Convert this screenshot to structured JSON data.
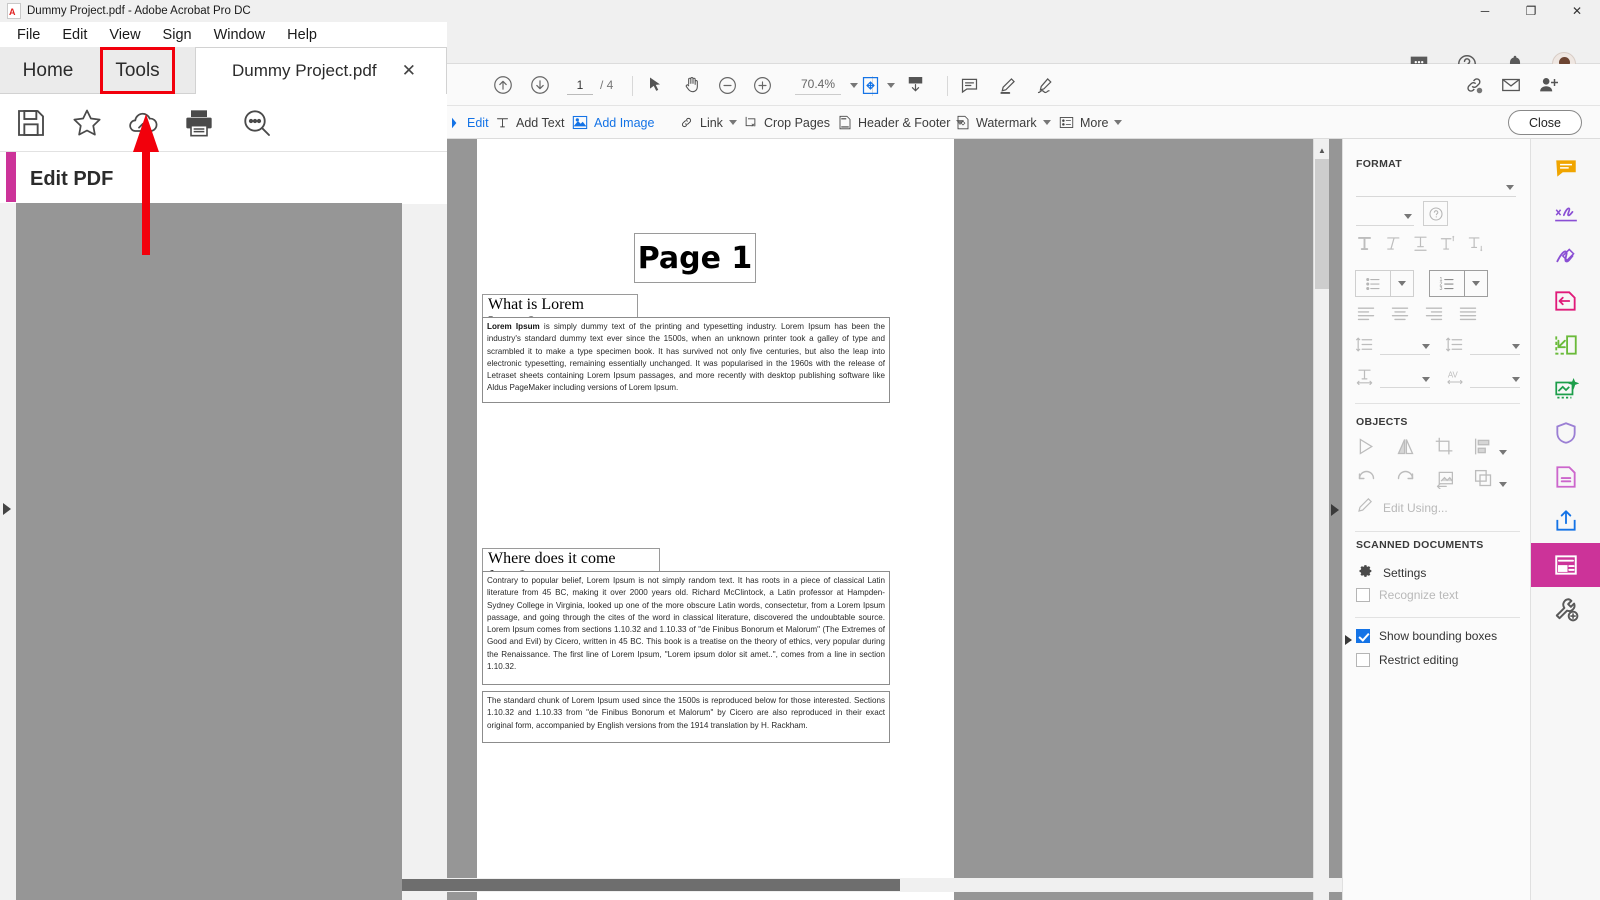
{
  "window": {
    "title": "Dummy Project.pdf - Adobe Acrobat Pro DC",
    "app_icon": "pdf-file-icon",
    "minimize": "─",
    "maximize": "❐",
    "close": "✕"
  },
  "menubar": {
    "items": [
      {
        "label": "File",
        "name": "menu-file"
      },
      {
        "label": "Edit",
        "name": "menu-edit"
      },
      {
        "label": "View",
        "name": "menu-view"
      },
      {
        "label": "Sign",
        "name": "menu-sign"
      },
      {
        "label": "Window",
        "name": "menu-window"
      },
      {
        "label": "Help",
        "name": "menu-help"
      }
    ]
  },
  "tabs": {
    "home": "Home",
    "tools": "Tools",
    "document": "Dummy Project.pdf",
    "close_glyph": "✕",
    "highlight_color": "#f2000c"
  },
  "quick_toolbar": {
    "icons": [
      {
        "name": "save-icon",
        "title": "Save"
      },
      {
        "name": "star-icon",
        "title": "Add to favorites"
      },
      {
        "name": "cloud-upload-icon",
        "title": "Save to cloud"
      },
      {
        "name": "print-icon",
        "title": "Print"
      },
      {
        "name": "search-icon",
        "title": "Find"
      }
    ]
  },
  "tool_header": {
    "label": "Edit PDF",
    "accent_color": "#cc3399"
  },
  "header_icons": [
    {
      "name": "chat-bubble-icon"
    },
    {
      "name": "help-circle-icon"
    },
    {
      "name": "bell-icon"
    },
    {
      "name": "avatar"
    }
  ],
  "navbar": {
    "prev_page_icon": "arrow-up-circle-icon",
    "next_page_icon": "arrow-down-circle-icon",
    "current_page": "1",
    "page_separator": "/ 4",
    "total_pages": "4",
    "select_tool_icon": "cursor-arrow-icon",
    "hand_tool_icon": "hand-icon",
    "zoom_out_icon": "minus-circle-icon",
    "zoom_in_icon": "plus-circle-icon",
    "zoom_level": "70.4%",
    "fit_page_icon": "fit-page-icon",
    "scroll_mode_icon": "scroll-mode-icon",
    "comment_icon": "comment-icon",
    "highlight_icon": "highlighter-icon",
    "draw_icon": "draw-icon",
    "share_link_icon": "share-link-icon",
    "email_icon": "email-icon",
    "add_person_icon": "add-person-icon"
  },
  "edit_toolbar": {
    "items": [
      {
        "label": "Edit",
        "name": "edit-button",
        "icon": "edit-icon",
        "blue": true,
        "caret": false
      },
      {
        "label": "Add Text",
        "name": "add-text-button",
        "icon": "text-icon",
        "blue": false,
        "caret": false
      },
      {
        "label": "Add Image",
        "name": "add-image-button",
        "icon": "image-icon",
        "blue": true,
        "caret": false
      },
      {
        "label": "Link",
        "name": "link-button",
        "icon": "link-icon",
        "blue": false,
        "caret": true
      },
      {
        "label": "Crop Pages",
        "name": "crop-pages-button",
        "icon": "crop-icon",
        "blue": false,
        "caret": false
      },
      {
        "label": "Header & Footer",
        "name": "header-footer-button",
        "icon": "header-footer-icon",
        "blue": false,
        "caret": true
      },
      {
        "label": "Watermark",
        "name": "watermark-button",
        "icon": "watermark-icon",
        "blue": false,
        "caret": true
      },
      {
        "label": "More",
        "name": "more-button",
        "icon": "more-list-icon",
        "blue": false,
        "caret": true
      }
    ],
    "close_label": "Close"
  },
  "document": {
    "page_title": "Page 1",
    "heading_1": "What is Lorem Ipsum?",
    "paragraph_1_bold": "Lorem Ipsum",
    "paragraph_1": " is simply dummy text of the printing and typesetting industry. Lorem Ipsum has been the industry's standard dummy text ever since the 1500s, when an unknown printer took a galley of type and scrambled it to make a type specimen book. It has survived not only five centuries, but also the leap into electronic typesetting, remaining essentially unchanged. It was popularised in the 1960s with the release of Letraset sheets containing Lorem Ipsum passages, and more recently with desktop publishing software like Aldus PageMaker including versions of Lorem Ipsum.",
    "heading_2": "Where does it come from?",
    "paragraph_2": "Contrary to popular belief, Lorem Ipsum is not simply random text. It has roots in a piece of classical Latin literature from 45 BC, making it over 2000 years old. Richard McClintock, a Latin professor at Hampden-Sydney College in Virginia, looked up one of the more obscure Latin words, consectetur, from a Lorem Ipsum passage, and going through the cites of the word in classical literature, discovered the undoubtable source. Lorem Ipsum comes from sections 1.10.32 and 1.10.33 of \"de Finibus Bonorum et Malorum\" (The Extremes of Good and Evil) by Cicero, written in 45 BC. This book is a treatise on the theory of ethics, very popular during the Renaissance. The first line of Lorem Ipsum, \"Lorem ipsum dolor sit amet..\", comes from a line in section 1.10.32.",
    "paragraph_3": "The standard chunk of Lorem Ipsum used since the 1500s is reproduced below for those interested. Sections 1.10.32 and 1.10.33 from \"de Finibus Bonorum et Malorum\" by Cicero are also reproduced in their exact original form, accompanied by English versions from the 1914 translation by H. Rackham."
  },
  "format_panel": {
    "section_format": "FORMAT",
    "section_objects": "OBJECTS",
    "section_scanned": "SCANNED DOCUMENTS",
    "font_dropdown_value": "",
    "font_size_value": "",
    "help_icon": "question-circle-icon",
    "text_style_icons": [
      {
        "name": "bold-icon",
        "glyph": "T"
      },
      {
        "name": "italic-icon",
        "glyph": "T"
      },
      {
        "name": "underline-icon",
        "glyph": "T"
      },
      {
        "name": "superscript-icon",
        "glyph": "T"
      },
      {
        "name": "subscript-icon",
        "glyph": "T"
      }
    ],
    "list_icons": [
      {
        "name": "bulleted-list-icon"
      },
      {
        "name": "bulleted-list-dropdown"
      },
      {
        "name": "numbered-list-icon"
      },
      {
        "name": "numbered-list-dropdown"
      }
    ],
    "align_icons": [
      {
        "name": "align-left-icon"
      },
      {
        "name": "align-center-icon"
      },
      {
        "name": "align-right-icon"
      },
      {
        "name": "align-justify-icon"
      }
    ],
    "spacing_icons": [
      {
        "name": "line-spacing-icon"
      },
      {
        "name": "paragraph-spacing-icon"
      },
      {
        "name": "horizontal-scale-icon"
      },
      {
        "name": "character-spacing-icon"
      }
    ],
    "object_icons_row1": [
      {
        "name": "flip-horizontal-icon"
      },
      {
        "name": "flip-vertical-icon"
      },
      {
        "name": "crop-image-icon"
      },
      {
        "name": "align-objects-icon"
      }
    ],
    "object_icons_row2": [
      {
        "name": "rotate-counterclockwise-icon"
      },
      {
        "name": "rotate-clockwise-icon"
      },
      {
        "name": "replace-image-icon"
      },
      {
        "name": "arrange-objects-icon"
      }
    ],
    "edit_using_label": "Edit Using...",
    "edit_using_icon": "pencil-icon",
    "settings_label": "Settings",
    "settings_icon": "gear-icon",
    "recognize_text_label": "Recognize text",
    "recognize_text_checked": false,
    "show_bounding_boxes_label": "Show bounding boxes",
    "show_bounding_boxes_checked": true,
    "restrict_editing_label": "Restrict editing",
    "restrict_editing_checked": false
  },
  "right_rail": [
    {
      "name": "comment-tool-icon",
      "color": "#f0a500",
      "active": false
    },
    {
      "name": "fill-and-sign-tool-icon",
      "color": "#8a4fd4",
      "active": false
    },
    {
      "name": "sign-tool-icon",
      "color": "#8a4fd4",
      "active": false
    },
    {
      "name": "export-pdf-tool-icon",
      "color": "#e01b7a",
      "active": false
    },
    {
      "name": "create-pdf-tool-icon",
      "color": "#6aba3a",
      "active": false
    },
    {
      "name": "enhance-scans-tool-icon",
      "color": "#1c9e4a",
      "active": false
    },
    {
      "name": "protect-tool-icon",
      "color": "#9b7fd4",
      "active": false
    },
    {
      "name": "compress-pdf-tool-icon",
      "color": "#cc66cc",
      "active": false
    },
    {
      "name": "send-for-review-tool-icon",
      "color": "#1473e6",
      "active": false
    },
    {
      "name": "edit-pdf-tool-icon",
      "color": "#ffffff",
      "active": true
    },
    {
      "name": "more-tools-icon",
      "color": "#5a5a5a",
      "active": false
    }
  ],
  "annotation": {
    "arrow_color": "#f2000c",
    "name": "red-pointer-arrow"
  }
}
